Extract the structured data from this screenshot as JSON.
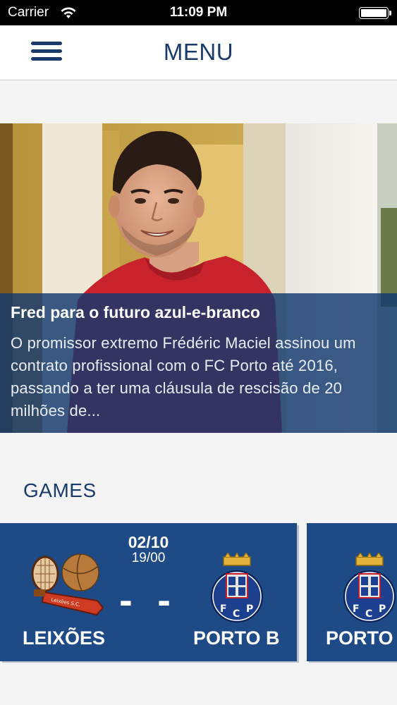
{
  "status_bar": {
    "carrier": "Carrier",
    "time": "11:09 PM",
    "battery_level": 1.0
  },
  "nav": {
    "title": "MENU",
    "menu_icon": "hamburger-icon"
  },
  "news": {
    "title": "Fred para o futuro azul-e-branco",
    "excerpt": "O promissor extremo Frédéric Maciel assinou um contrato profissional com o FC Porto até 2016, passando a ter uma cláusula de rescisão de 20 milhões de..."
  },
  "games": {
    "section_title": "GAMES",
    "items": [
      {
        "date": "02/10",
        "time": "19/00",
        "score": "- -",
        "home_team": "LEIXÕES",
        "away_team": "PORTO B"
      },
      {
        "away_team": "PORTO"
      }
    ]
  },
  "colors": {
    "brand_blue": "#1a3a6b",
    "card_blue": "#1e4a86",
    "overlay_blue": "#12386e"
  }
}
